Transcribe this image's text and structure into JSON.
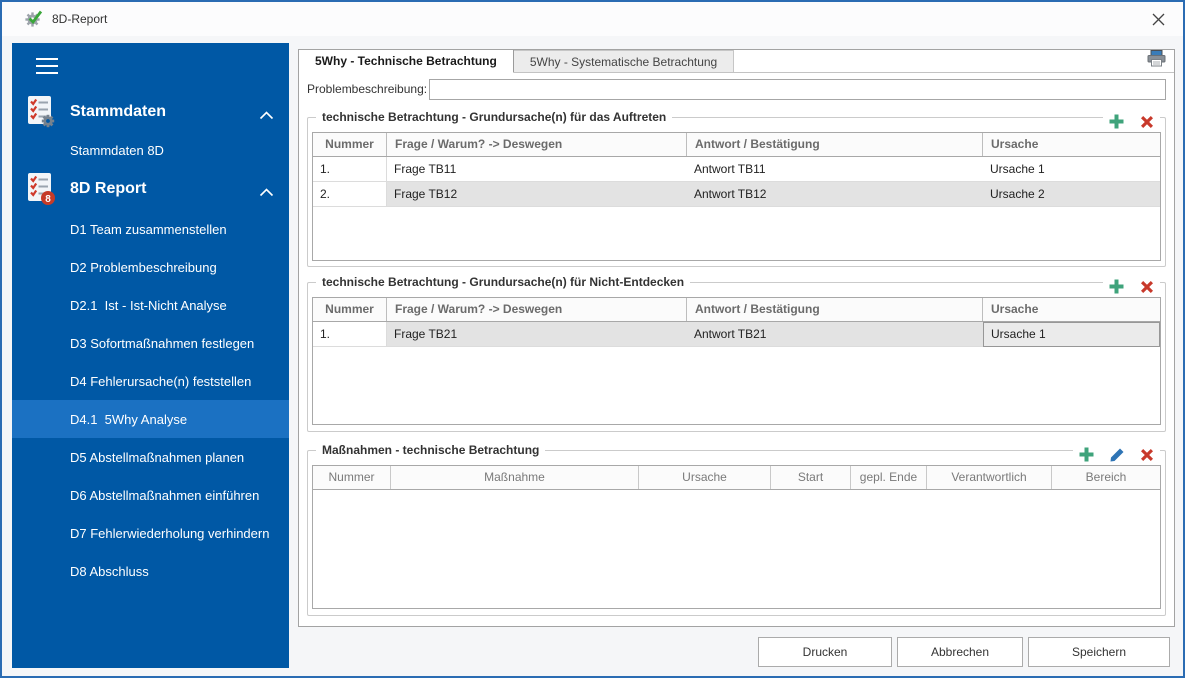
{
  "window": {
    "title": "8D-Report"
  },
  "sidebar": {
    "sections": [
      {
        "label": "Stammdaten",
        "items": [
          {
            "label": "Stammdaten 8D"
          }
        ]
      },
      {
        "label": "8D Report",
        "badge": "8",
        "items": [
          {
            "label": "D1 Team zusammenstellen"
          },
          {
            "label": "D2 Problembeschreibung"
          },
          {
            "label": "D2.1  Ist - Ist-Nicht Analyse"
          },
          {
            "label": "D3 Sofortmaßnahmen festlegen"
          },
          {
            "label": "D4 Fehlerursache(n) feststellen"
          },
          {
            "label": "D4.1  5Why Analyse"
          },
          {
            "label": "D5 Abstellmaßnahmen planen"
          },
          {
            "label": "D6 Abstellmaßnahmen einführen"
          },
          {
            "label": "D7 Fehlerwiederholung verhindern"
          },
          {
            "label": "D8 Abschluss"
          }
        ]
      }
    ]
  },
  "tabs": [
    {
      "label": "5Why - Technische Betrachtung"
    },
    {
      "label": "5Why - Systematische Betrachtung"
    }
  ],
  "problem": {
    "label": "Problembeschreibung:",
    "value": ""
  },
  "groups": [
    {
      "title": "technische Betrachtung - Grundursache(n) für das Auftreten",
      "columns": [
        "Nummer",
        "Frage / Warum? -> Deswegen",
        "Antwort / Bestätigung",
        "Ursache"
      ],
      "rows": [
        [
          "1.",
          "Frage TB11",
          "Antwort TB11",
          "Ursache 1"
        ],
        [
          "2.",
          "Frage TB12",
          "Antwort TB12",
          "Ursache 2"
        ]
      ]
    },
    {
      "title": "technische Betrachtung - Grundursache(n) für Nicht-Entdecken",
      "columns": [
        "Nummer",
        "Frage / Warum? -> Deswegen",
        "Antwort / Bestätigung",
        "Ursache"
      ],
      "rows": [
        [
          "1.",
          "Frage TB21",
          "Antwort TB21",
          "Ursache 1"
        ]
      ]
    },
    {
      "title": "Maßnahmen - technische Betrachtung",
      "columns": [
        "Nummer",
        "Maßnahme",
        "Ursache",
        "Start",
        "gepl. Ende",
        "Verantwortlich",
        "Bereich"
      ],
      "rows": []
    }
  ],
  "buttons": [
    {
      "label": "Drucken"
    },
    {
      "label": "Abbrechen"
    },
    {
      "label": "Speichern"
    }
  ],
  "colors": {
    "sidebar": "#0058A5",
    "sidebar_selected": "#1B71C2",
    "accent_green": "#3FA37B",
    "accent_red": "#C8392B",
    "accent_blue": "#2E74B5",
    "window_border": "#2B6CB3"
  }
}
